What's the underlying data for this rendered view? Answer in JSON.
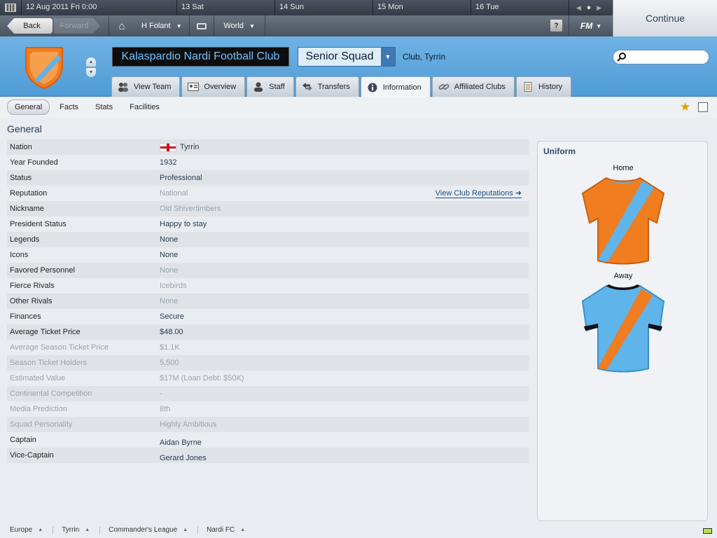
{
  "calendar": {
    "date": "12 Aug 2011",
    "day": "Fri",
    "time": "0:00",
    "days": [
      "13 Sat",
      "14 Sun",
      "15 Mon",
      "16 Tue"
    ]
  },
  "nav": {
    "back_label": "Back",
    "forward_label": "Forward",
    "manager_label": "H Folant",
    "world_label": "World",
    "help_label": "?",
    "fm_label": "FM"
  },
  "continue_label": "Continue",
  "header": {
    "club_name": "Kalaspardio Nardi Football Club",
    "squad_select": "Senior Squad",
    "location": "Club, Tyrrin",
    "search_placeholder": ""
  },
  "tabs": [
    {
      "label": "View Team",
      "icon": "people-icon"
    },
    {
      "label": "Overview",
      "icon": "id-card-icon"
    },
    {
      "label": "Staff",
      "icon": "person-icon"
    },
    {
      "label": "Transfers",
      "icon": "transfer-arrows-icon"
    },
    {
      "label": "Information",
      "icon": "info-icon"
    },
    {
      "label": "Affiliated Clubs",
      "icon": "link-icon"
    },
    {
      "label": "History",
      "icon": "notepad-icon"
    }
  ],
  "subtabs": [
    "General",
    "Facts",
    "Stats",
    "Facilities"
  ],
  "section_title": "General",
  "rows": [
    {
      "label": "Nation",
      "value": "Tyrrin"
    },
    {
      "label": "Year Founded",
      "value": "1932"
    },
    {
      "label": "Status",
      "value": "Professional"
    },
    {
      "label": "Reputation",
      "value": "National"
    },
    {
      "label": "Nickname",
      "value": "Old Shivertimbers"
    },
    {
      "label": "President Status",
      "value": "Happy to stay"
    },
    {
      "label": "Legends",
      "value": "None"
    },
    {
      "label": "Icons",
      "value": "None"
    },
    {
      "label": "Favored Personnel",
      "value": "None"
    },
    {
      "label": "Fierce Rivals",
      "value": "Icebirds"
    },
    {
      "label": "Other Rivals",
      "value": "None"
    },
    {
      "label": "Finances",
      "value": "Secure"
    },
    {
      "label": "Average Ticket Price",
      "value": "$48.00"
    },
    {
      "label": "Average Season Ticket Price",
      "value": "$1.1K"
    },
    {
      "label": "Season Ticket Holders",
      "value": "5,500"
    },
    {
      "label": "Estimated Value",
      "value": "$17M (Loan Debt: $50K)"
    },
    {
      "label": "Continental Competition",
      "value": "-"
    },
    {
      "label": "Media Prediction",
      "value": "8th"
    },
    {
      "label": "Squad Personality",
      "value": "Highly Ambitious"
    },
    {
      "label": "Captain",
      "value": "Aidan Byrne"
    },
    {
      "label": "Vice-Captain",
      "value": "Gerard Jones"
    }
  ],
  "reputation_link": "View Club Reputations",
  "uniform": {
    "title": "Uniform",
    "home_label": "Home",
    "away_label": "Away"
  },
  "breadcrumbs": [
    "Europe",
    "Tyrrin",
    "Commander's League",
    "Nardi FC"
  ],
  "colors": {
    "header_blue": "#5aa6dd",
    "club_orange": "#f07d1f",
    "club_sky": "#5fb4ea"
  }
}
